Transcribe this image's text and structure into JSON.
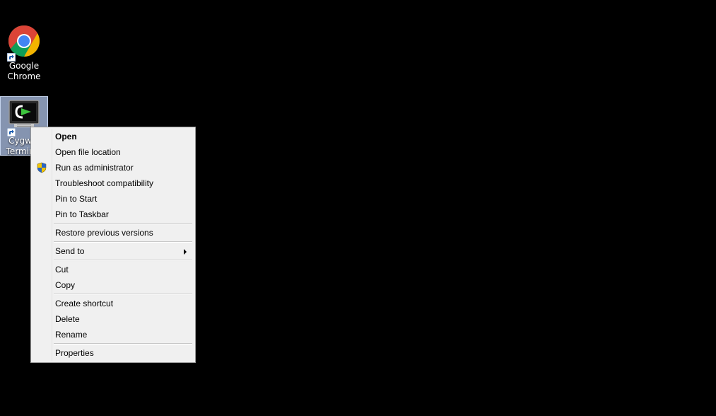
{
  "desktop": {
    "background": "#000000",
    "icons": [
      {
        "name": "chrome",
        "label": "Google\nChrome",
        "icon": "chrome-icon"
      },
      {
        "name": "cygwin",
        "label": "Cygwin\nTerminal",
        "icon": "cygwin-terminal-icon",
        "selected": true
      }
    ]
  },
  "context_menu": {
    "items": [
      {
        "label": "Open",
        "bold": true
      },
      {
        "label": "Open file location"
      },
      {
        "label": "Run as administrator",
        "icon": "uac-shield-icon"
      },
      {
        "label": "Troubleshoot compatibility"
      },
      {
        "label": "Pin to Start"
      },
      {
        "label": "Pin to Taskbar"
      },
      {
        "label": "Restore previous versions"
      },
      {
        "label": "Send to",
        "submenu": true
      },
      {
        "label": "Cut"
      },
      {
        "label": "Copy"
      },
      {
        "label": "Create shortcut"
      },
      {
        "label": "Delete"
      },
      {
        "label": "Rename"
      },
      {
        "label": "Properties"
      }
    ]
  }
}
